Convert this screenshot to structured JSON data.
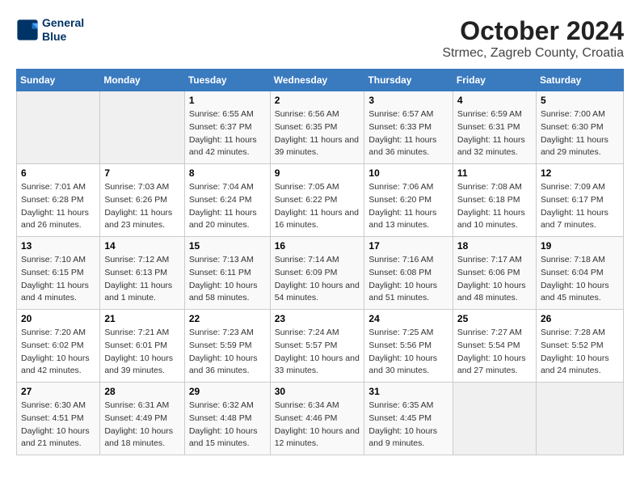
{
  "header": {
    "logo_line1": "General",
    "logo_line2": "Blue",
    "month": "October 2024",
    "location": "Strmec, Zagreb County, Croatia"
  },
  "days_of_week": [
    "Sunday",
    "Monday",
    "Tuesday",
    "Wednesday",
    "Thursday",
    "Friday",
    "Saturday"
  ],
  "weeks": [
    [
      {
        "num": "",
        "data": ""
      },
      {
        "num": "",
        "data": ""
      },
      {
        "num": "1",
        "data": "Sunrise: 6:55 AM\nSunset: 6:37 PM\nDaylight: 11 hours and 42 minutes."
      },
      {
        "num": "2",
        "data": "Sunrise: 6:56 AM\nSunset: 6:35 PM\nDaylight: 11 hours and 39 minutes."
      },
      {
        "num": "3",
        "data": "Sunrise: 6:57 AM\nSunset: 6:33 PM\nDaylight: 11 hours and 36 minutes."
      },
      {
        "num": "4",
        "data": "Sunrise: 6:59 AM\nSunset: 6:31 PM\nDaylight: 11 hours and 32 minutes."
      },
      {
        "num": "5",
        "data": "Sunrise: 7:00 AM\nSunset: 6:30 PM\nDaylight: 11 hours and 29 minutes."
      }
    ],
    [
      {
        "num": "6",
        "data": "Sunrise: 7:01 AM\nSunset: 6:28 PM\nDaylight: 11 hours and 26 minutes."
      },
      {
        "num": "7",
        "data": "Sunrise: 7:03 AM\nSunset: 6:26 PM\nDaylight: 11 hours and 23 minutes."
      },
      {
        "num": "8",
        "data": "Sunrise: 7:04 AM\nSunset: 6:24 PM\nDaylight: 11 hours and 20 minutes."
      },
      {
        "num": "9",
        "data": "Sunrise: 7:05 AM\nSunset: 6:22 PM\nDaylight: 11 hours and 16 minutes."
      },
      {
        "num": "10",
        "data": "Sunrise: 7:06 AM\nSunset: 6:20 PM\nDaylight: 11 hours and 13 minutes."
      },
      {
        "num": "11",
        "data": "Sunrise: 7:08 AM\nSunset: 6:18 PM\nDaylight: 11 hours and 10 minutes."
      },
      {
        "num": "12",
        "data": "Sunrise: 7:09 AM\nSunset: 6:17 PM\nDaylight: 11 hours and 7 minutes."
      }
    ],
    [
      {
        "num": "13",
        "data": "Sunrise: 7:10 AM\nSunset: 6:15 PM\nDaylight: 11 hours and 4 minutes."
      },
      {
        "num": "14",
        "data": "Sunrise: 7:12 AM\nSunset: 6:13 PM\nDaylight: 11 hours and 1 minute."
      },
      {
        "num": "15",
        "data": "Sunrise: 7:13 AM\nSunset: 6:11 PM\nDaylight: 10 hours and 58 minutes."
      },
      {
        "num": "16",
        "data": "Sunrise: 7:14 AM\nSunset: 6:09 PM\nDaylight: 10 hours and 54 minutes."
      },
      {
        "num": "17",
        "data": "Sunrise: 7:16 AM\nSunset: 6:08 PM\nDaylight: 10 hours and 51 minutes."
      },
      {
        "num": "18",
        "data": "Sunrise: 7:17 AM\nSunset: 6:06 PM\nDaylight: 10 hours and 48 minutes."
      },
      {
        "num": "19",
        "data": "Sunrise: 7:18 AM\nSunset: 6:04 PM\nDaylight: 10 hours and 45 minutes."
      }
    ],
    [
      {
        "num": "20",
        "data": "Sunrise: 7:20 AM\nSunset: 6:02 PM\nDaylight: 10 hours and 42 minutes."
      },
      {
        "num": "21",
        "data": "Sunrise: 7:21 AM\nSunset: 6:01 PM\nDaylight: 10 hours and 39 minutes."
      },
      {
        "num": "22",
        "data": "Sunrise: 7:23 AM\nSunset: 5:59 PM\nDaylight: 10 hours and 36 minutes."
      },
      {
        "num": "23",
        "data": "Sunrise: 7:24 AM\nSunset: 5:57 PM\nDaylight: 10 hours and 33 minutes."
      },
      {
        "num": "24",
        "data": "Sunrise: 7:25 AM\nSunset: 5:56 PM\nDaylight: 10 hours and 30 minutes."
      },
      {
        "num": "25",
        "data": "Sunrise: 7:27 AM\nSunset: 5:54 PM\nDaylight: 10 hours and 27 minutes."
      },
      {
        "num": "26",
        "data": "Sunrise: 7:28 AM\nSunset: 5:52 PM\nDaylight: 10 hours and 24 minutes."
      }
    ],
    [
      {
        "num": "27",
        "data": "Sunrise: 6:30 AM\nSunset: 4:51 PM\nDaylight: 10 hours and 21 minutes."
      },
      {
        "num": "28",
        "data": "Sunrise: 6:31 AM\nSunset: 4:49 PM\nDaylight: 10 hours and 18 minutes."
      },
      {
        "num": "29",
        "data": "Sunrise: 6:32 AM\nSunset: 4:48 PM\nDaylight: 10 hours and 15 minutes."
      },
      {
        "num": "30",
        "data": "Sunrise: 6:34 AM\nSunset: 4:46 PM\nDaylight: 10 hours and 12 minutes."
      },
      {
        "num": "31",
        "data": "Sunrise: 6:35 AM\nSunset: 4:45 PM\nDaylight: 10 hours and 9 minutes."
      },
      {
        "num": "",
        "data": ""
      },
      {
        "num": "",
        "data": ""
      }
    ]
  ]
}
